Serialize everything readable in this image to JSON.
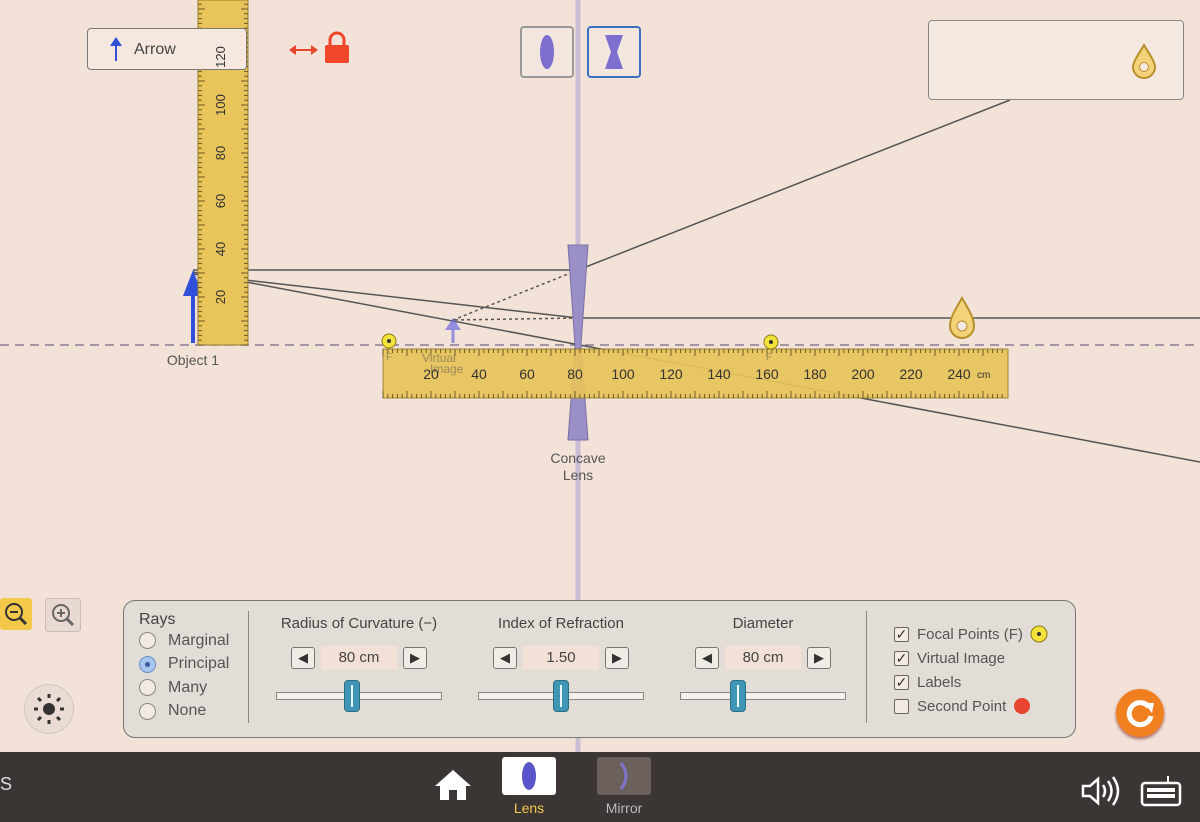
{
  "object_selector": {
    "selected": "Arrow",
    "icon": "blue-arrow-icon"
  },
  "vertical_ruler": {
    "ticks": [
      "20",
      "40",
      "60",
      "80",
      "100",
      "120"
    ]
  },
  "horizontal_ruler": {
    "ticks": [
      "20",
      "40",
      "60",
      "80",
      "100",
      "120",
      "140",
      "160",
      "180",
      "200",
      "220",
      "240"
    ],
    "unit": "cm",
    "focal_label_left": "F",
    "focal_label_right": "F"
  },
  "lens_types": [
    {
      "name": "convex",
      "selected": false
    },
    {
      "name": "concave",
      "selected": true
    }
  ],
  "scene": {
    "object_label": "Object 1",
    "lens_label_line1": "Concave",
    "lens_label_line2": "Lens",
    "virtual_image_label_line1": "Virtual",
    "virtual_image_label_line2": "Image"
  },
  "controls": {
    "rays": {
      "title": "Rays",
      "options": [
        "Marginal",
        "Principal",
        "Many",
        "None"
      ],
      "selected": "Principal"
    },
    "radius": {
      "title": "Radius of Curvature (−)",
      "value": "80 cm",
      "slider_fraction": 0.45
    },
    "index": {
      "title": "Index of Refraction",
      "value": "1.50",
      "slider_fraction": 0.5
    },
    "diameter": {
      "title": "Diameter",
      "value": "80 cm",
      "slider_fraction": 0.33
    },
    "checkboxes": [
      {
        "label": "Focal Points (F)",
        "checked": true
      },
      {
        "label": "Virtual Image",
        "checked": true
      },
      {
        "label": "Labels",
        "checked": true
      },
      {
        "label": "Second Point",
        "checked": false
      }
    ]
  },
  "nav": {
    "screens": [
      {
        "label": "Lens",
        "selected": true
      },
      {
        "label": "Mirror",
        "selected": false
      }
    ],
    "left_letter": "S"
  },
  "colors": {
    "accent": "#3b6fc4",
    "lens": "#9b8fc7",
    "ruler": "#e8c45a",
    "focal": "#f2e23a",
    "second_point": "#e8442e",
    "reset": "#f07f1f",
    "lock": "#f0462a"
  }
}
